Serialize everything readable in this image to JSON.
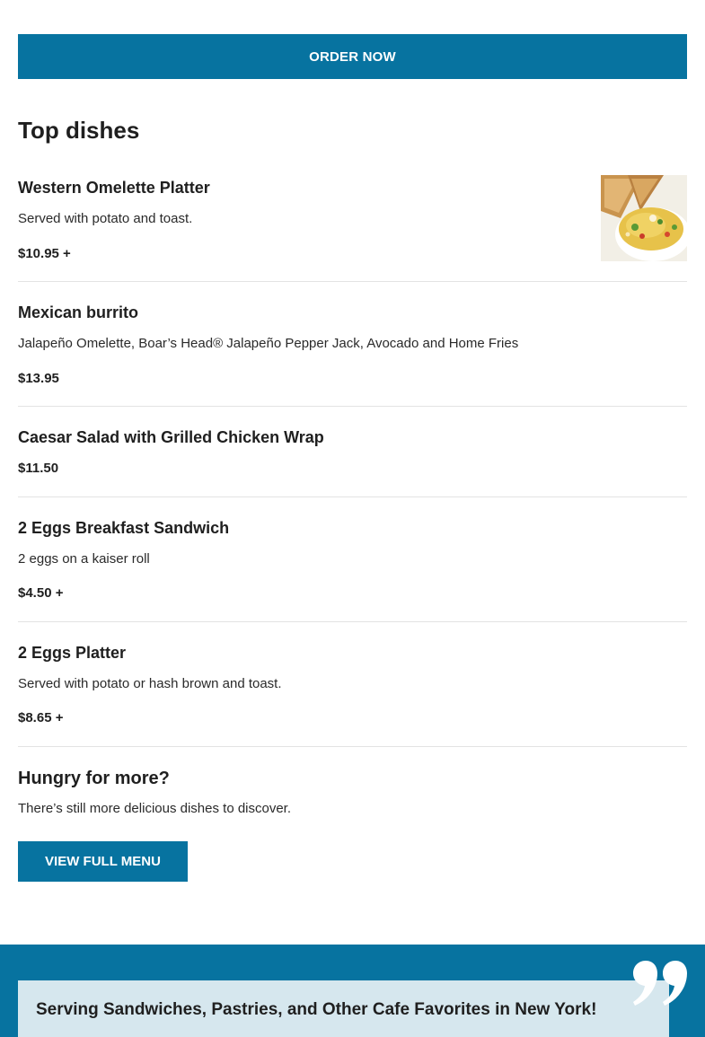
{
  "order_button": {
    "label": "ORDER NOW"
  },
  "top_dishes": {
    "title": "Top dishes",
    "items": [
      {
        "name": "Western Omelette Platter",
        "description": "Served with potato and toast.",
        "price": "$10.95 +",
        "image": "omelette-platter-photo"
      },
      {
        "name": "Mexican burrito",
        "description": "Jalapeño Omelette, Boar’s Head® Jalapeño Pepper Jack, Avocado and Home Fries",
        "price": "$13.95"
      },
      {
        "name": "Caesar Salad with Grilled Chicken Wrap",
        "price": "$11.50"
      },
      {
        "name": "2 Eggs Breakfast Sandwich",
        "description": "2 eggs on a kaiser roll",
        "price": "$4.50 +"
      },
      {
        "name": "2 Eggs Platter",
        "description": "Served with potato or hash brown and toast.",
        "price": "$8.65 +"
      }
    ]
  },
  "more": {
    "title": "Hungry for more?",
    "subtitle": "There’s still more delicious dishes to discover.",
    "button_label": "VIEW FULL MENU"
  },
  "testimonial": {
    "heading": "Serving Sandwiches, Pastries, and Other Cafe Favorites in New York!",
    "icon": "quote-icon"
  },
  "colors": {
    "accent": "#0773a0",
    "card": "#d6e7ee",
    "divider": "#e3e3e3",
    "text": "#1f1f1f"
  }
}
